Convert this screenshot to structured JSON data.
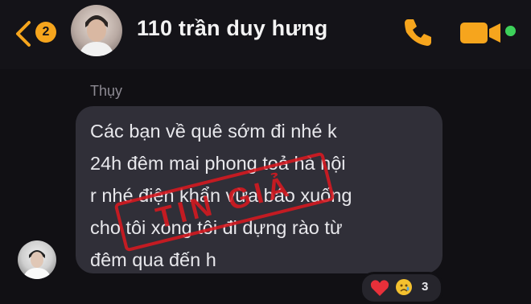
{
  "header": {
    "unread_count": "2",
    "contact_name": "110 trần duy hưng",
    "accent_color": "#f6a51d",
    "online_color": "#3dd15a",
    "icons": [
      "back-chevron-icon",
      "phone-icon",
      "video-camera-icon",
      "online-status-dot-icon"
    ]
  },
  "conversation": {
    "sender_name": "Thụy",
    "message": "Các bạn về quê sớm đi nhé k\n24h đêm mai phong toả hà nội\nr nhé điện khẩn vừa báo xuống\ncho tôi xong tôi đi dựng rào từ\nđêm qua đến h",
    "stamp_text": "TIN GIẢ",
    "stamp_color": "#d81920",
    "reactions": {
      "emojis": [
        "heart-icon",
        "crying-face-icon"
      ],
      "count": "3"
    }
  }
}
